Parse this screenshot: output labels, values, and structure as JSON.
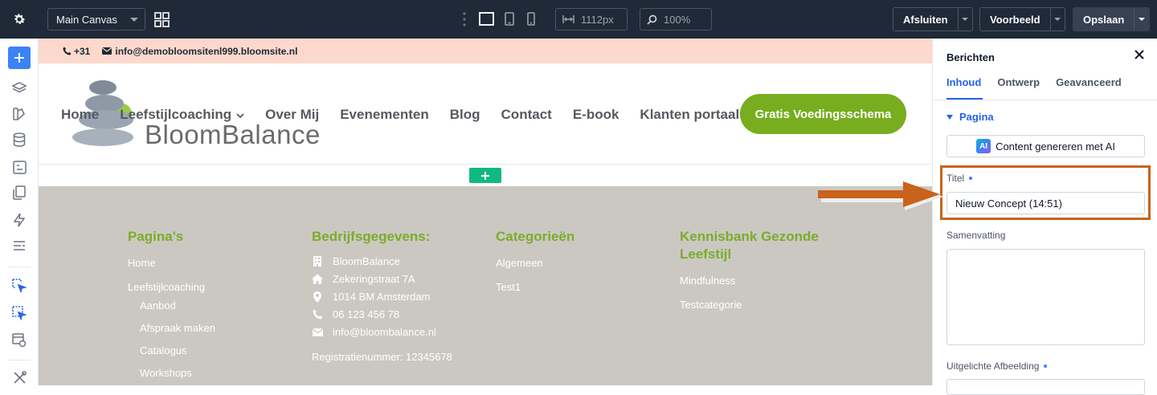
{
  "topbar": {
    "canvas_select": "Main Canvas",
    "width_value": "1112px",
    "zoom_value": "100%",
    "exit_label": "Afsluiten",
    "preview_label": "Voorbeeld",
    "save_label": "Opslaan"
  },
  "site": {
    "phone": "+31",
    "email": "info@demobloomsitenl999.bloomsite.nl",
    "logo_text": "BloomBalance",
    "nav": [
      "Home",
      "Leefstijlcoaching",
      "Over Mij",
      "Evenementen",
      "Blog",
      "Contact",
      "E-book",
      "Klanten portaal"
    ],
    "cta": "Gratis Voedingsschema",
    "footer": {
      "col1_title": "Pagina's",
      "col1_links": [
        "Home",
        "Leefstijlcoaching"
      ],
      "col1_sublinks": [
        "Aanbod",
        "Afspraak maken",
        "Catalogus",
        "Workshops"
      ],
      "col2_title": "Bedrijfsgegevens:",
      "company": "BloomBalance",
      "street": "Zekeringstraat 7A",
      "city": "1014 BM Amsterdam",
      "phone": "06 123 456 78",
      "email": "info@bloombalance.nl",
      "registration": "Registratienummer: 12345678",
      "col3_title": "Categorieën",
      "col3_links": [
        "Algemeen",
        "Test1"
      ],
      "col4_title": "Kennisbank Gezonde Leefstijl",
      "col4_links": [
        "Mindfulness",
        "Testcategorie"
      ]
    }
  },
  "panel": {
    "title": "Berichten",
    "tabs": [
      "Inhoud",
      "Ontwerp",
      "Geavanceerd"
    ],
    "section": "Pagina",
    "ai_badge": "AI",
    "ai_button": "Content genereren met AI",
    "title_label": "Titel",
    "title_value": "Nieuw Concept (14:51)",
    "summary_label": "Samenvatting",
    "featured_label": "Uitgelichte Afbeelding"
  },
  "colors": {
    "topbar_bg": "#1f2937",
    "accent_blue": "#2563eb",
    "brand_green": "#77ad1f",
    "highlight_orange": "#c9621b",
    "footer_bg": "#cbc8c2",
    "info_bar_bg": "#fcd9cc"
  }
}
